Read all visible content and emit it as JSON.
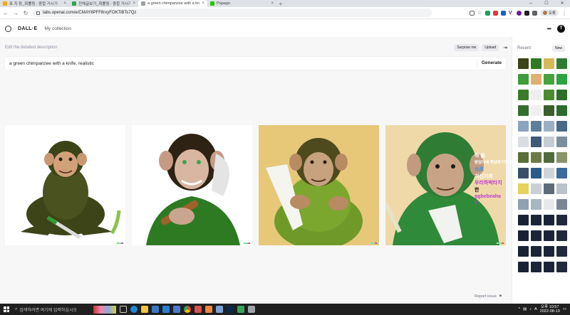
{
  "browser": {
    "tabs": [
      {
        "label": "표 지 탕_획률됨 : 종합 거시기",
        "favicon": "#f9ab00",
        "active": false
      },
      {
        "label": "전체글보기_획률됨 : 종합 거시기",
        "favicon": "#2ea44f",
        "active": false
      },
      {
        "label": "a green chimpanzee with a knife",
        "favicon": "#9aa0a6",
        "active": true
      },
      {
        "label": "Papago",
        "favicon": "#1ec800",
        "active": false
      }
    ],
    "new_tab": "+",
    "url": "labs.openai.com/e/CMAY8PFF8rxyFOKTiBTs7Qz",
    "profile_label": "오류"
  },
  "app": {
    "brand": "DALL·E",
    "my_collection": "My collection",
    "user_initial": "T",
    "more_icon": "•••"
  },
  "editor": {
    "label": "Edit the detailed description",
    "surprise_label": "Surprise me",
    "upload_label": "Upload",
    "prompt_value": "a green chimpanzee with a knife, realistic",
    "generate_label": "Generate"
  },
  "overlay_text": [
    {
      "text": "하 을",
      "color": "#ffffff"
    },
    {
      "text": "받았다에 쪽냈까기하네",
      "color": "#ffffff"
    },
    {
      "text": "스의",
      "color": "#2b8be6"
    },
    {
      "text": "거신기회",
      "color": "#ffffff"
    },
    {
      "text": "우리하박타치",
      "color": "#c23ad6"
    },
    {
      "text": "한",
      "color": "#111111"
    },
    {
      "text": "ggbebeaha",
      "color": "#c23ad6"
    },
    {
      "text": "?",
      "color": "#c23ad6"
    }
  ],
  "report_label": "Report issue",
  "sidebar": {
    "title": "Recent",
    "new_label": "New"
  },
  "taskbar": {
    "search_placeholder": "검색하려면 여기에 입력하십시오",
    "time": "오후 10:57",
    "date": "2022-08-19"
  }
}
